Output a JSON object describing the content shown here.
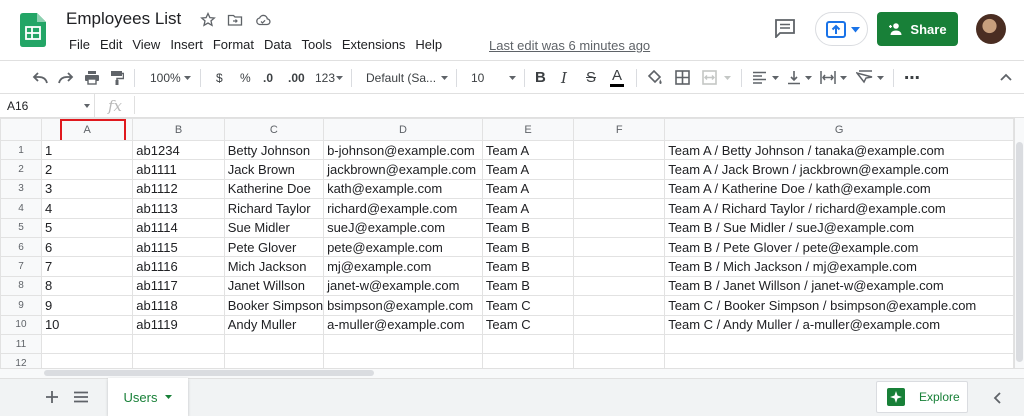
{
  "header": {
    "title": "Employees List",
    "menu": [
      "File",
      "Edit",
      "View",
      "Insert",
      "Format",
      "Data",
      "Tools",
      "Extensions",
      "Help"
    ],
    "last_edit": "Last edit was 6 minutes ago",
    "share_label": "Share"
  },
  "toolbar": {
    "zoom": "100%",
    "currency": "$",
    "percent": "%",
    "dec_decrease": ".0",
    "dec_increase": ".00",
    "more_formats": "123",
    "font": "Default (Sa...",
    "font_size": "10",
    "bold": "B",
    "italic": "I",
    "strike": "S",
    "text_color": "A",
    "more": "⋯"
  },
  "formula_bar": {
    "name_box": "A16",
    "fx": "fx"
  },
  "grid": {
    "columns": [
      "A",
      "B",
      "C",
      "D",
      "E",
      "F",
      "G"
    ],
    "selected_column": "A",
    "rows": [
      {
        "n": "1",
        "cells": [
          "1",
          "ab1234",
          "Betty Johnson",
          "b-johnson@example.com",
          "Team A",
          "",
          "Team A / Betty Johnson / tanaka@example.com"
        ]
      },
      {
        "n": "2",
        "cells": [
          "2",
          "ab1111",
          "Jack Brown",
          "jackbrown@example.com",
          "Team A",
          "",
          "Team A / Jack Brown / jackbrown@example.com"
        ]
      },
      {
        "n": "3",
        "cells": [
          "3",
          "ab1112",
          "Katherine Doe",
          "kath@example.com",
          "Team A",
          "",
          "Team A / Katherine Doe / kath@example.com"
        ]
      },
      {
        "n": "4",
        "cells": [
          "4",
          "ab1113",
          "Richard Taylor",
          "richard@example.com",
          "Team A",
          "",
          "Team A / Richard Taylor / richard@example.com"
        ]
      },
      {
        "n": "5",
        "cells": [
          "5",
          "ab1114",
          "Sue Midler",
          "sueJ@example.com",
          "Team B",
          "",
          "Team B / Sue Midler / sueJ@example.com"
        ]
      },
      {
        "n": "6",
        "cells": [
          "6",
          "ab1115",
          "Pete Glover",
          "pete@example.com",
          "Team B",
          "",
          "Team B / Pete Glover / pete@example.com"
        ]
      },
      {
        "n": "7",
        "cells": [
          "7",
          "ab1116",
          "Mich Jackson",
          "mj@example.com",
          "Team B",
          "",
          "Team B / Mich Jackson / mj@example.com"
        ]
      },
      {
        "n": "8",
        "cells": [
          "8",
          "ab1117",
          "Janet Willson",
          "janet-w@example.com",
          "Team B",
          "",
          "Team B / Janet Willson / janet-w@example.com"
        ]
      },
      {
        "n": "9",
        "cells": [
          "9",
          "ab1118",
          "Booker Simpson",
          "bsimpson@example.com",
          "Team C",
          "",
          "Team C / Booker Simpson / bsimpson@example.com"
        ]
      },
      {
        "n": "10",
        "cells": [
          "10",
          "ab1119",
          "Andy Muller",
          "a-muller@example.com",
          "Team C",
          "",
          "Team C / Andy Muller / a-muller@example.com"
        ]
      },
      {
        "n": "11",
        "cells": [
          "",
          "",
          "",
          "",
          "",
          "",
          ""
        ]
      },
      {
        "n": "12",
        "cells": [
          "",
          "",
          "",
          "",
          "",
          "",
          ""
        ]
      }
    ]
  },
  "bottom": {
    "sheet_tab": "Users",
    "explore": "Explore"
  },
  "colors": {
    "brand_green": "#188038",
    "selection_red": "#e0191e"
  }
}
